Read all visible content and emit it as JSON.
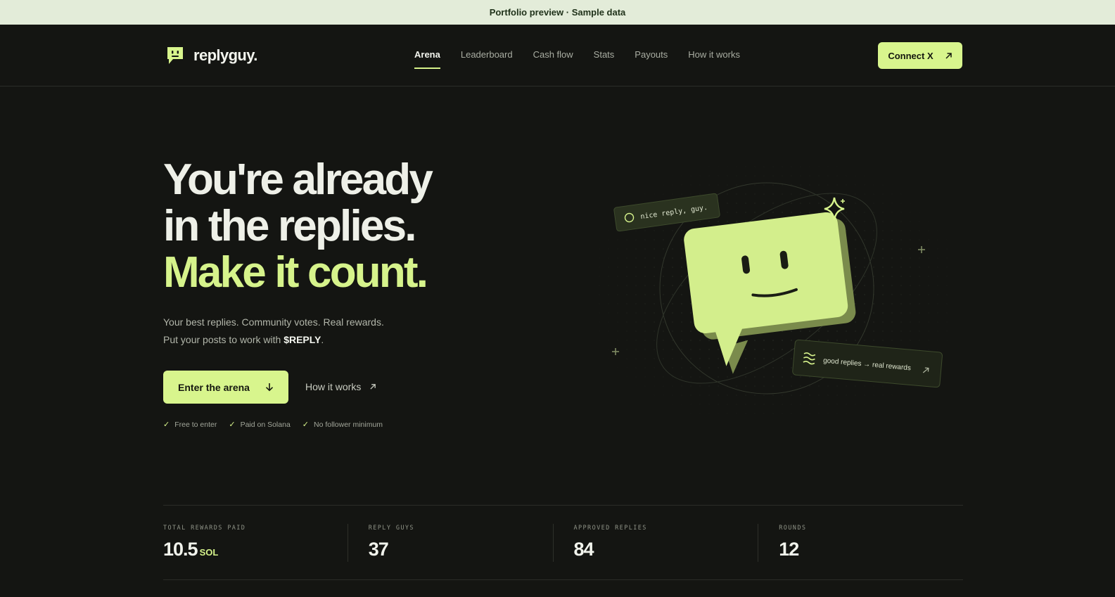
{
  "banner": {
    "text": "Portfolio preview · Sample data"
  },
  "brand": {
    "name_bold": "reply",
    "name_rest": "guy."
  },
  "nav": {
    "links": [
      {
        "label": "Arena",
        "active": true
      },
      {
        "label": "Leaderboard",
        "active": false
      },
      {
        "label": "Cash flow",
        "active": false
      },
      {
        "label": "Stats",
        "active": false
      },
      {
        "label": "Payouts",
        "active": false
      },
      {
        "label": "How it works",
        "active": false
      }
    ],
    "connect_label": "Connect X"
  },
  "hero": {
    "line1": "You're already",
    "line2": "in the replies.",
    "line3": "Make it count.",
    "sub1": "Your best replies. Community votes. Real rewards.",
    "sub2_pre": "Put your posts to work with ",
    "sub2_token": "$REPLY",
    "sub2_post": ".",
    "cta_label": "Enter the arena",
    "secondary_label": "How it works",
    "checks": [
      "Free to enter",
      "Paid on Solana",
      "No follower minimum"
    ]
  },
  "illustration": {
    "bubble_left": "nice reply, guy.",
    "bubble_right": "good replies → real rewards"
  },
  "stats": [
    {
      "label": "TOTAL REWARDS PAID",
      "value": "10.5",
      "unit": "SOL"
    },
    {
      "label": "REPLY GUYS",
      "value": "37",
      "unit": ""
    },
    {
      "label": "APPROVED REPLIES",
      "value": "84",
      "unit": ""
    },
    {
      "label": "ROUNDS",
      "value": "12",
      "unit": ""
    }
  ],
  "colors": {
    "accent": "#d8f58d",
    "background": "#141512",
    "banner": "#e3ecd9"
  }
}
